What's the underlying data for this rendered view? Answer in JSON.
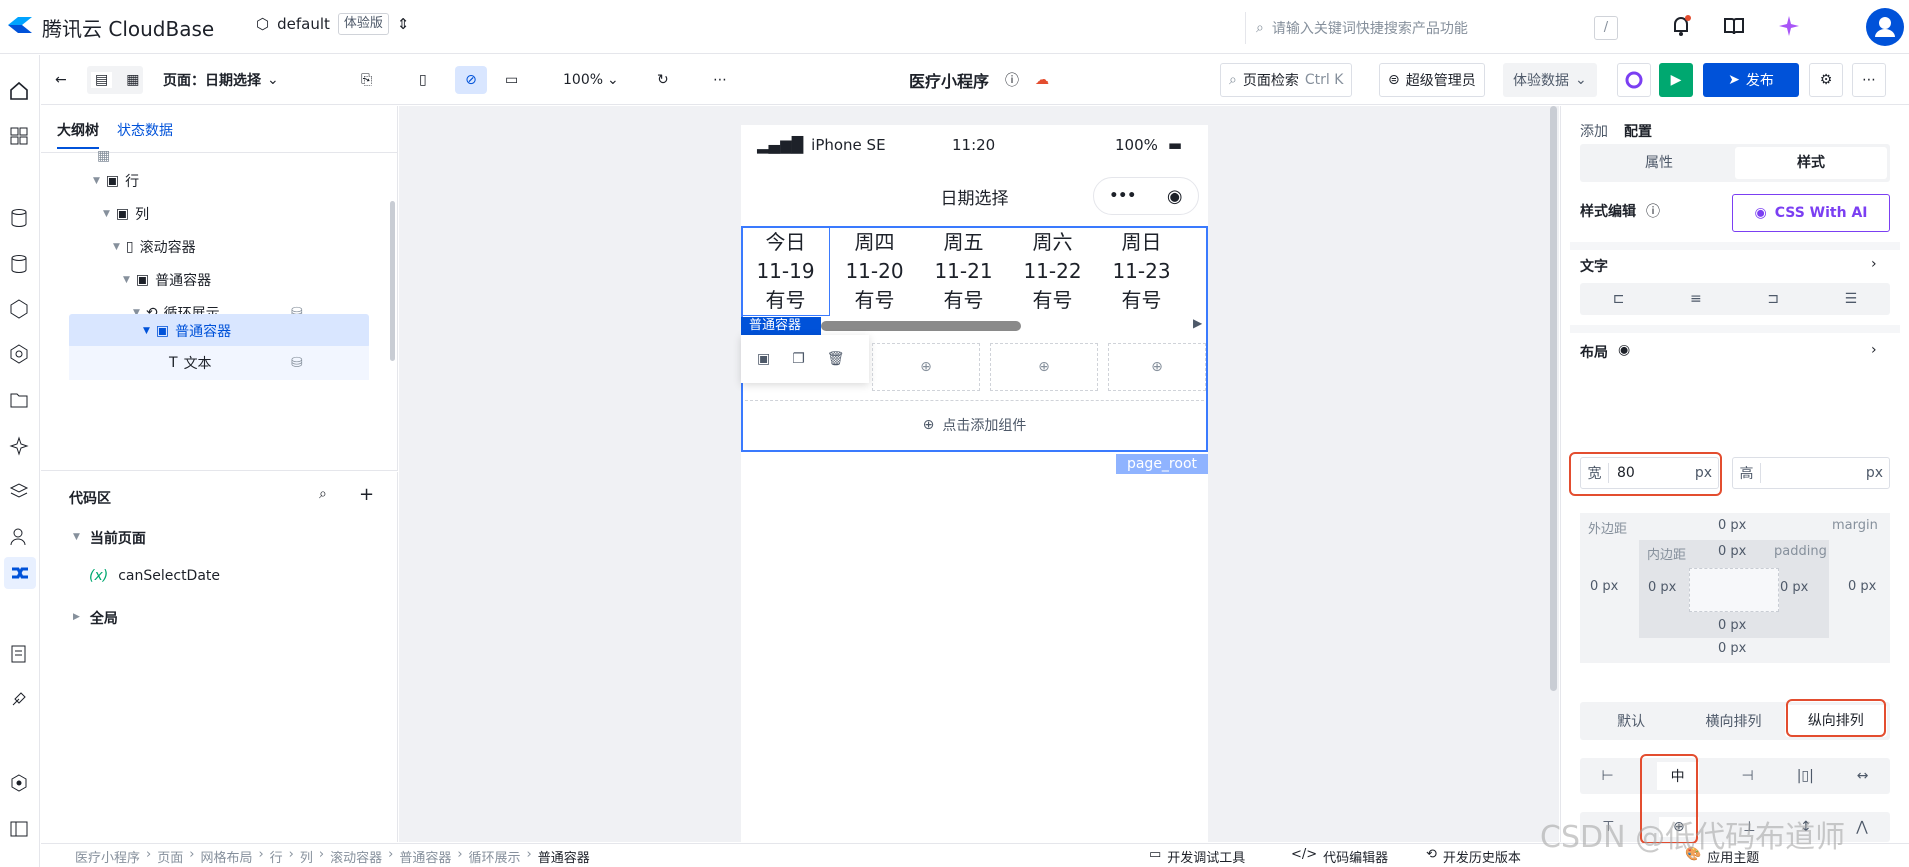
{
  "app": {
    "brand": "腾讯云 CloudBase",
    "env_name": "default",
    "env_badge": "体验版",
    "search_placeholder": "请输入关键词快捷搜索产品功能",
    "search_kbd": "/"
  },
  "toolbar": {
    "page_label": "页面：日期选择",
    "zoom": "100%",
    "title": "医疗小程序",
    "page_search": "页面检索",
    "page_search_kbd": "Ctrl K",
    "role": "超级管理员",
    "data_mode": "体验数据",
    "publish": "发布"
  },
  "outline": {
    "tabs": [
      "大纲树",
      "状态数据"
    ],
    "nodes": [
      {
        "label": "行"
      },
      {
        "label": "列"
      },
      {
        "label": "滚动容器"
      },
      {
        "label": "普通容器"
      },
      {
        "label": "循环展示"
      },
      {
        "label": "普通容器"
      },
      {
        "label": "文本"
      }
    ]
  },
  "code": {
    "title": "代码区",
    "current_page": "当前页面",
    "variable": "canSelectDate",
    "global": "全局"
  },
  "phone": {
    "carrier": "iPhone SE",
    "time": "11:20",
    "battery": "100%",
    "nav_title": "日期选择",
    "days": [
      {
        "week": "今日",
        "date": "11-19",
        "status": "有号"
      },
      {
        "week": "周四",
        "date": "11-20",
        "status": "有号"
      },
      {
        "week": "周五",
        "date": "11-21",
        "status": "有号"
      },
      {
        "week": "周六",
        "date": "11-22",
        "status": "有号"
      },
      {
        "week": "周日",
        "date": "11-23",
        "status": "有号"
      }
    ],
    "container_tag": "普通容器",
    "add_component": "点击添加组件",
    "root_tag": "page_root"
  },
  "right": {
    "tabs": [
      "添加",
      "配置"
    ],
    "seg": [
      "属性",
      "样式"
    ],
    "style_edit": "样式编辑",
    "css_ai": "CSS With AI",
    "text_section": "文字",
    "layout_section": "布局",
    "width_label": "宽",
    "width_value": "80",
    "width_unit": "px",
    "height_label": "高",
    "height_unit": "px",
    "margin_label": "外边距",
    "margin_en": "margin",
    "padding_label": "内边距",
    "padding_en": "padding",
    "zero": "0 px",
    "dir": [
      "默认",
      "横向排列",
      "纵向排列"
    ],
    "center_glyph": "中",
    "apply_theme": "应用主题"
  },
  "statusbar": {
    "crumbs": [
      "医疗小程序",
      "页面",
      "网格布局",
      "行",
      "列",
      "滚动容器",
      "普通容器",
      "循环展示",
      "普通容器"
    ],
    "tools": [
      "开发调试工具",
      "代码编辑器",
      "开发历史版本"
    ]
  },
  "watermark": "CSDN @低代码布道师",
  "colors": {
    "primary": "#0052d9",
    "highlight": "#e34d2f",
    "selection": "#d9e6ff"
  }
}
